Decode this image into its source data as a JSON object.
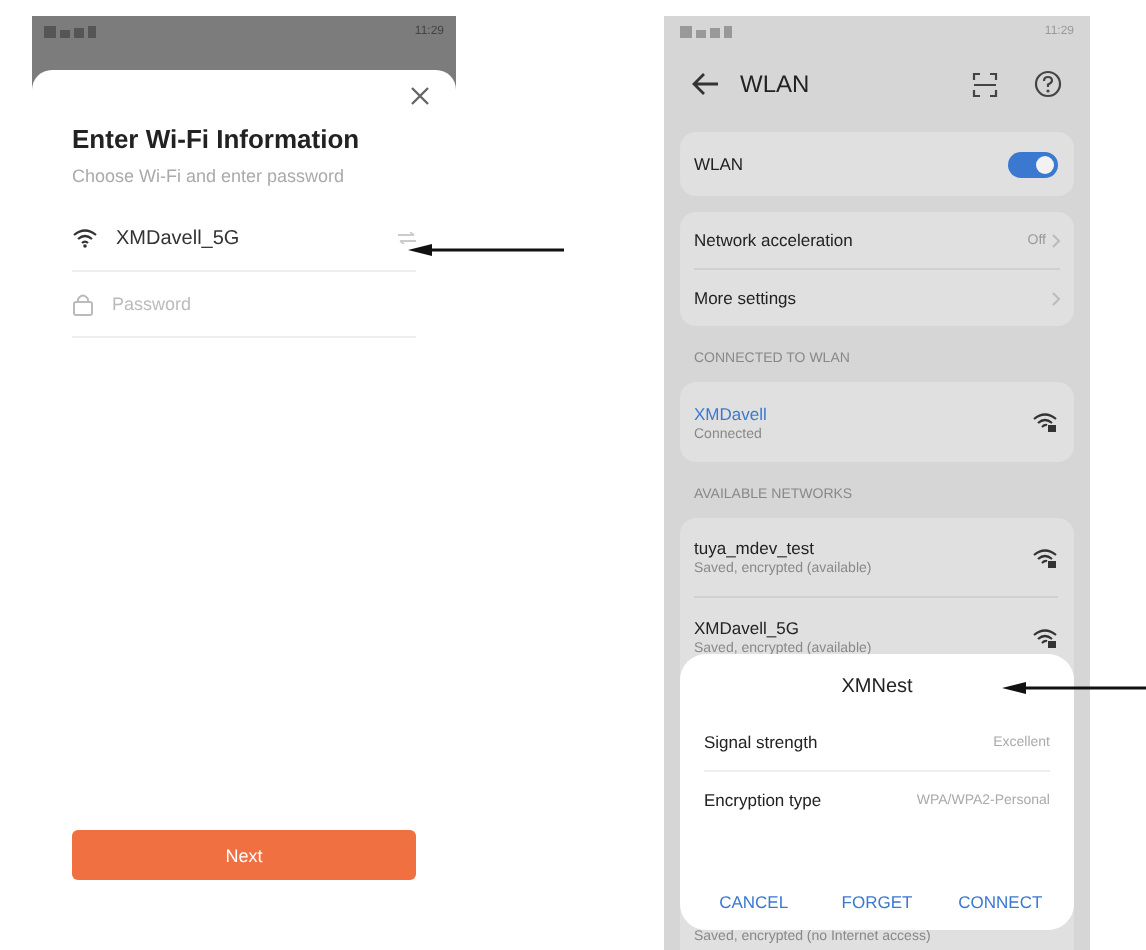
{
  "left_screen": {
    "status_bar": {
      "time": "11:29"
    },
    "title": "Enter Wi-Fi Information",
    "subtitle": "Choose Wi-Fi and enter password",
    "network": {
      "name": "XMDavell_5G"
    },
    "password": {
      "placeholder": "Password"
    },
    "next_button": "Next"
  },
  "right_screen": {
    "status_bar": {
      "time": "11:29"
    },
    "title": "WLAN",
    "wlan_toggle": {
      "label": "WLAN",
      "on": true
    },
    "settings": [
      {
        "label": "Network acceleration",
        "value": "Off"
      },
      {
        "label": "More settings"
      }
    ],
    "connected_section": "CONNECTED TO WLAN",
    "connected": {
      "name": "XMDavell",
      "status": "Connected"
    },
    "available_section": "AVAILABLE NETWORKS",
    "available": [
      {
        "name": "tuya_mdev_test",
        "status": "Saved, encrypted (available)"
      },
      {
        "name": "XMDavell_5G",
        "status": "Saved, encrypted (available)"
      }
    ],
    "last_network": {
      "status": "Saved, encrypted (no Internet access)"
    },
    "dialog": {
      "title": "XMNest",
      "rows": [
        {
          "label": "Signal strength",
          "value": "Excellent"
        },
        {
          "label": "Encryption type",
          "value": "WPA/WPA2-Personal"
        }
      ],
      "buttons": [
        "CANCEL",
        "FORGET",
        "CONNECT"
      ]
    }
  }
}
